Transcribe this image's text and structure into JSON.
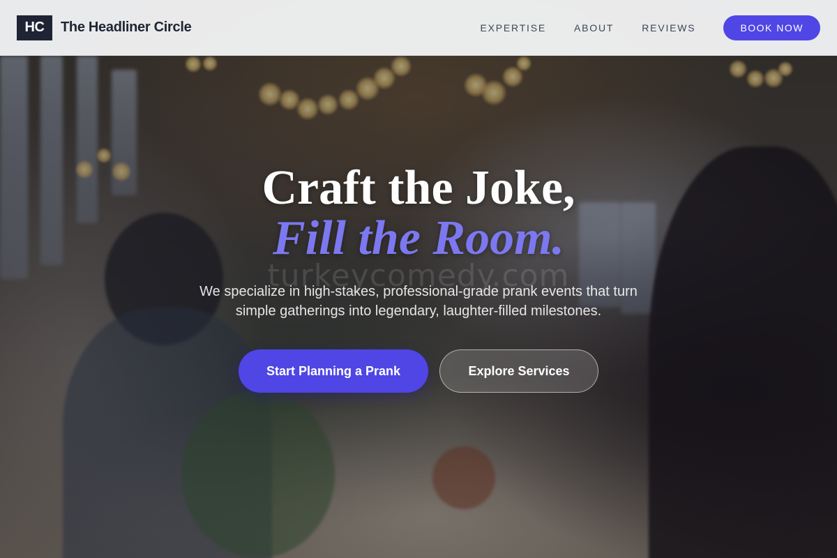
{
  "brand": {
    "logo_text": "HC",
    "name": "The Headliner Circle"
  },
  "nav": {
    "items": [
      {
        "label": "EXPERTISE"
      },
      {
        "label": "ABOUT"
      },
      {
        "label": "REVIEWS"
      }
    ],
    "cta_label": "BOOK NOW"
  },
  "hero": {
    "headline_line1": "Craft the Joke,",
    "headline_line2": "Fill the Room.",
    "subtext": "We specialize in high-stakes, professional-grade prank events that turn simple gatherings into legendary, laughter-filled milestones.",
    "primary_cta": "Start Planning a Prank",
    "secondary_cta": "Explore Services",
    "watermark": "turkeycomedy.com"
  },
  "colors": {
    "accent": "#4f46e5",
    "accent_light": "#7c78f0",
    "brand_dark": "#1e2433",
    "header_bg": "#f5f6f8"
  },
  "background_image": "blurred banquet hall with guests raising champagne glasses, string lights"
}
